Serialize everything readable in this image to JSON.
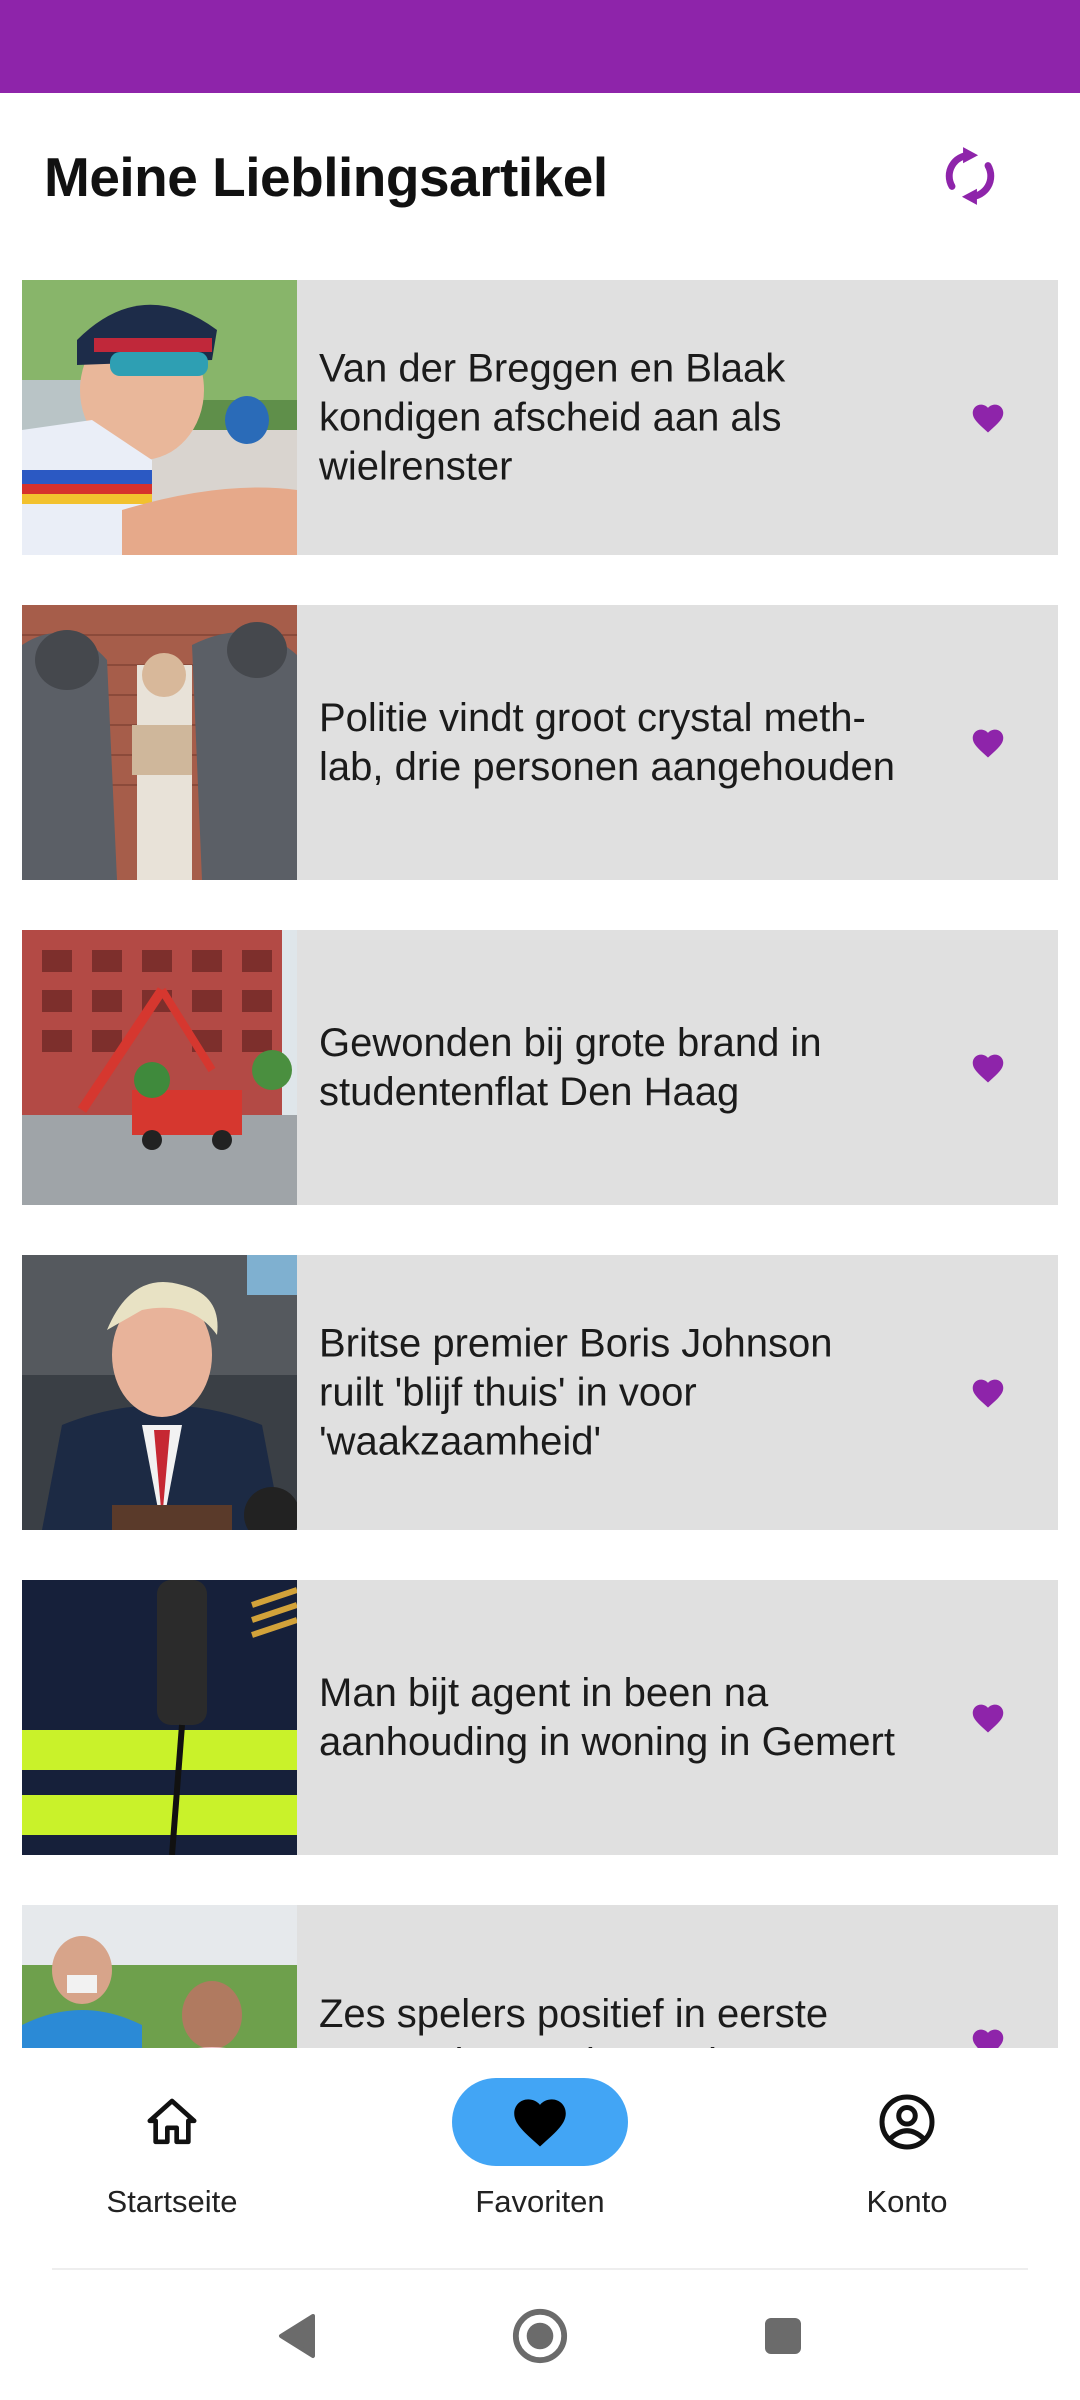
{
  "header": {
    "title": "Meine Lieblingsartikel",
    "refresh_icon": "refresh-icon"
  },
  "colors": {
    "accent": "#8e24aa",
    "card_bg": "#e0e0e0",
    "nav_active": "#42a5f5"
  },
  "articles": [
    {
      "title": "Van der Breggen en Blaak kondigen afscheid aan als wielrenster",
      "favorite": true
    },
    {
      "title": "Politie vindt groot crystal meth-lab, drie personen aangehouden",
      "favorite": true
    },
    {
      "title": "Gewonden bij grote brand in studentenflat Den Haag",
      "favorite": true
    },
    {
      "title": "Britse premier Boris Johnson ruilt 'blijf thuis' in voor 'waakzaamheid'",
      "favorite": true
    },
    {
      "title": "Man bijt agent in been na aanhouding in woning in Gemert",
      "favorite": true
    },
    {
      "title": "Zes spelers positief in eerste testronde voor hervatting La",
      "favorite": true
    }
  ],
  "nav": {
    "items": [
      {
        "label": "Startseite",
        "icon": "home-icon",
        "active": false
      },
      {
        "label": "Favoriten",
        "icon": "heart-icon",
        "active": true
      },
      {
        "label": "Konto",
        "icon": "account-circle-icon",
        "active": false
      }
    ]
  },
  "system_nav": {
    "back": "back-icon",
    "home": "home-circle-icon",
    "recents": "recents-icon"
  }
}
